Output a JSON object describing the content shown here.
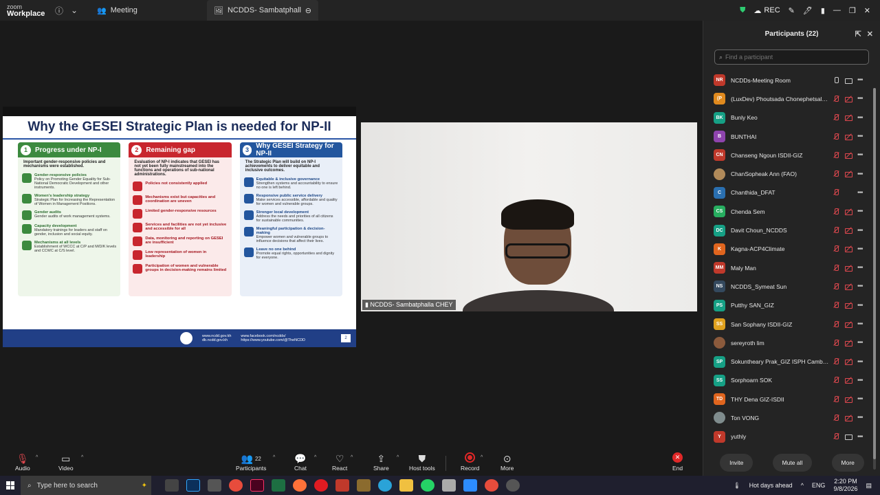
{
  "topbar": {
    "brand_line1": "zoom",
    "brand_line2": "Workplace",
    "meeting_tab": "Meeting",
    "share_tab": "NCDDS- Sambatphalla CHEY's scr",
    "rec_label": "REC"
  },
  "slide": {
    "title": "Why the GESEI Strategic Plan is needed for NP-II",
    "columns": [
      {
        "num": "1",
        "heading": "Progress under NP-I",
        "intro": "Important gender-responsive policies and mechanisms were established.",
        "items": [
          {
            "title": "Gender-responsive policies",
            "desc": "Policy on Promoting Gender Equality for Sub-National Democratic Development and other instruments."
          },
          {
            "title": "Women's leadership strategy",
            "desc": "Strategic Plan for Increasing the Representation of Women in Management Positions."
          },
          {
            "title": "Gender audits",
            "desc": "Gender audits of work management systems."
          },
          {
            "title": "Capacity development",
            "desc": "Mandatory trainings for leaders and staff on gender, inclusion and social equity."
          },
          {
            "title": "Mechanisms at all levels",
            "desc": "Establishment of WCCC at C/P and M/D/K levels and CCWC at C/S level."
          }
        ]
      },
      {
        "num": "2",
        "heading": "Remaining gap",
        "intro": "Evaluation of NP-I indicates that GESEI has not yet been fully mainstreamed into the functions and operations of sub-national administrations.",
        "items": [
          {
            "title": "Policies not consistently applied",
            "desc": ""
          },
          {
            "title": "Mechanisms exist but capacities and coordination are uneven",
            "desc": ""
          },
          {
            "title": "Limited gender-responsive resources",
            "desc": ""
          },
          {
            "title": "Services and facilities are not yet inclusive and accessible for all",
            "desc": ""
          },
          {
            "title": "Data, monitoring and reporting on GESEI are insufficient",
            "desc": ""
          },
          {
            "title": "Low representation of women in leadership",
            "desc": ""
          },
          {
            "title": "Participation of women and vulnerable groups in decision-making remains limited",
            "desc": ""
          }
        ]
      },
      {
        "num": "3",
        "heading": "Why GESEI Strategy for NP-II",
        "intro": "The Strategic Plan will build on NP-I achievements to deliver equitable and inclusive outcomes.",
        "items": [
          {
            "title": "Equitable & inclusive governance",
            "desc": "Strengthen systems and accountability to ensure no one is left behind."
          },
          {
            "title": "Responsive public service delivery",
            "desc": "Make services accessible, affordable and quality for women and vulnerable groups."
          },
          {
            "title": "Stronger local development",
            "desc": "Address the needs and priorities of all citizens for sustainable communities."
          },
          {
            "title": "Meaningful participation & decision-making",
            "desc": "Empower women and vulnerable groups to influence decisions that affect their lives."
          },
          {
            "title": "Leave no one behind",
            "desc": "Promote equal rights, opportunities and dignity for everyone."
          }
        ]
      }
    ],
    "footer_web1": "www.ncdd.gov.kh",
    "footer_web2": "db.ncdd.gov.kh",
    "footer_fb": "www.facebook.com/ncdds/",
    "footer_yt": "https://www.youtube.com/@TheNCDD",
    "page": "2"
  },
  "video": {
    "name": "NCDDS- Sambatphalla CHEY"
  },
  "panel": {
    "title": "Participants (22)",
    "search_placeholder": "Find a participant",
    "participants": [
      {
        "initials": "NR",
        "name": "NCDDs-Meeting Room",
        "color": "#c0392b",
        "mic": "on",
        "cam": "on"
      },
      {
        "initials": "(P",
        "name": "(LuxDev) Phoutsada Chonephetsala...",
        "color": "#e08a1e",
        "mic": "off",
        "cam": "off"
      },
      {
        "initials": "BK",
        "name": "Bunly Keo",
        "color": "#16a085",
        "mic": "off",
        "cam": "off"
      },
      {
        "initials": "B",
        "name": "BUNTHAI",
        "color": "#8e44ad",
        "mic": "off",
        "cam": "off"
      },
      {
        "initials": "CN",
        "name": "Chanseng Ngoun ISDII-GIZ",
        "color": "#c0392b",
        "mic": "off",
        "cam": "off"
      },
      {
        "initials": "",
        "name": "ChanSopheak Ann (FAO)",
        "color": "#b08a5a",
        "mic": "off",
        "cam": "off",
        "img": true
      },
      {
        "initials": "C",
        "name": "Chanthida_DFAT",
        "color": "#2a6fb0",
        "mic": "off",
        "cam": "none"
      },
      {
        "initials": "CS",
        "name": "Chenda Sem",
        "color": "#27ae60",
        "mic": "off",
        "cam": "off"
      },
      {
        "initials": "DC",
        "name": "Davit Choun_NCDDS",
        "color": "#16a085",
        "mic": "off",
        "cam": "off"
      },
      {
        "initials": "K",
        "name": "Kagna-ACP4Climate",
        "color": "#e0651e",
        "mic": "off",
        "cam": "off"
      },
      {
        "initials": "MM",
        "name": "Maly Man",
        "color": "#c0392b",
        "mic": "off",
        "cam": "off"
      },
      {
        "initials": "NS",
        "name": "NCDDS_Symeat Sun",
        "color": "#34495e",
        "mic": "off",
        "cam": "off"
      },
      {
        "initials": "PS",
        "name": "Putthy SAN_GIZ",
        "color": "#16a085",
        "mic": "off",
        "cam": "off"
      },
      {
        "initials": "SS",
        "name": "San Sophany ISDII-GIZ",
        "color": "#e0a11e",
        "mic": "off",
        "cam": "off"
      },
      {
        "initials": "",
        "name": "sereyroth lim",
        "color": "#8b5a3c",
        "mic": "off",
        "cam": "off",
        "img": true
      },
      {
        "initials": "SP",
        "name": "Sokuntheary Prak_GIZ ISPH Cambo...",
        "color": "#16a085",
        "mic": "off",
        "cam": "off"
      },
      {
        "initials": "SS",
        "name": "Sorphoarn SOK",
        "color": "#16a085",
        "mic": "off",
        "cam": "off"
      },
      {
        "initials": "TD",
        "name": "THY Dena GIZ-ISDII",
        "color": "#e0651e",
        "mic": "off",
        "cam": "off"
      },
      {
        "initials": "",
        "name": "Ton VONG",
        "color": "#7f8c8d",
        "mic": "off",
        "cam": "off",
        "img": true
      },
      {
        "initials": "Y",
        "name": "yuthly",
        "color": "#c0392b",
        "mic": "off",
        "cam": "on"
      }
    ],
    "invite": "Invite",
    "mute_all": "Mute all",
    "more": "More"
  },
  "toolbar": {
    "audio": "Audio",
    "video": "Video",
    "participants": "Participants",
    "participants_count": "22",
    "chat": "Chat",
    "react": "React",
    "share": "Share",
    "host_tools": "Host tools",
    "record": "Record",
    "more": "More",
    "end": "End"
  },
  "taskbar": {
    "search_placeholder": "Type here to search",
    "weather": "Hot days ahead",
    "lang": "ENG",
    "time": "2:20 PM",
    "date": "9/8/2026"
  }
}
